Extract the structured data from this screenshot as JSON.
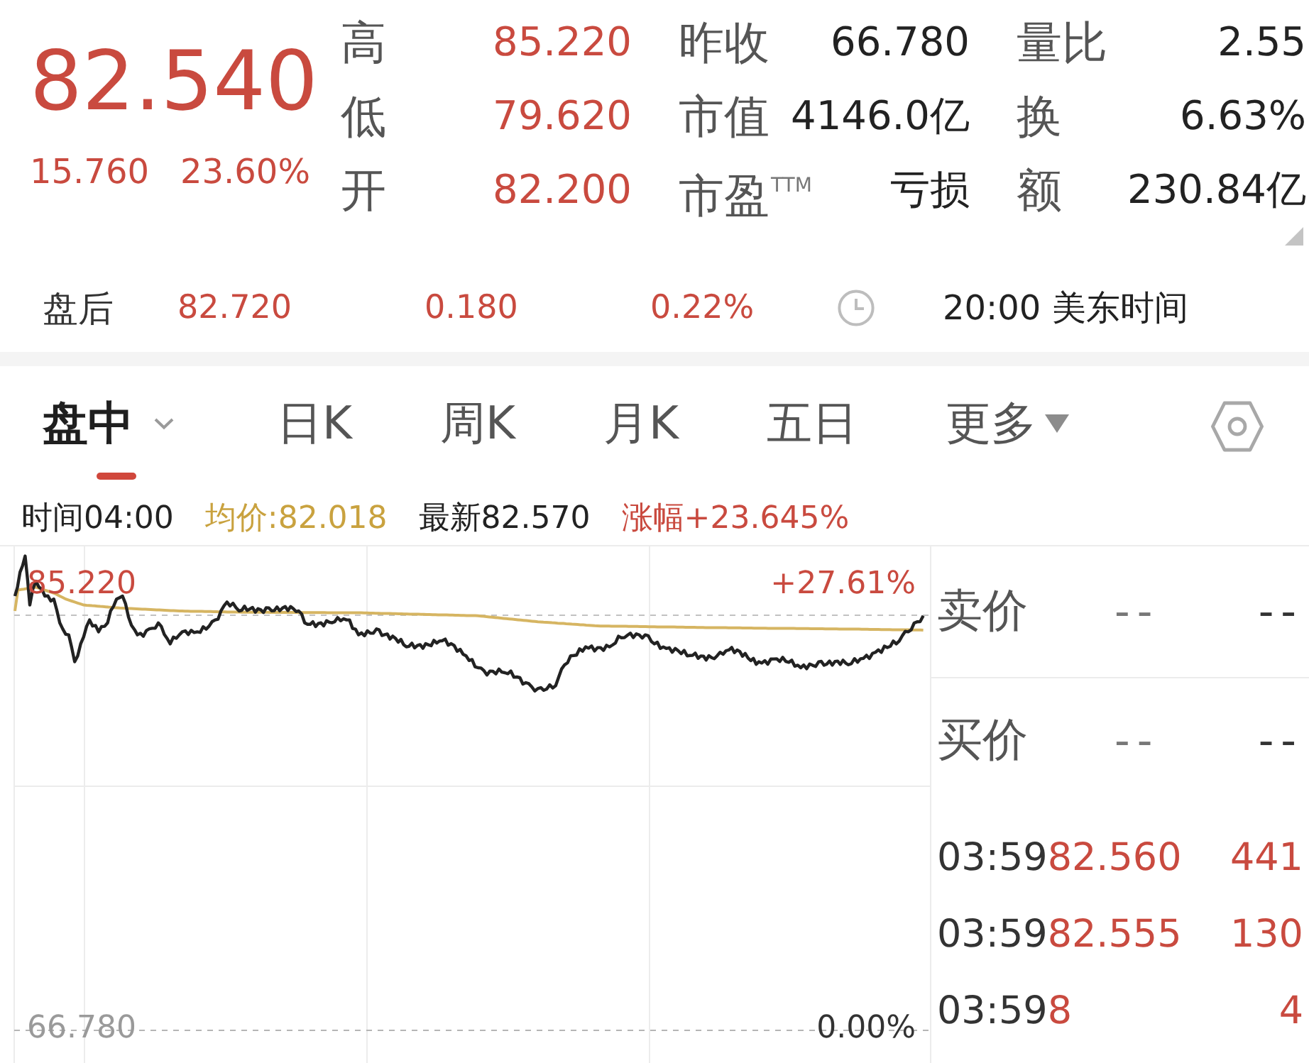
{
  "quote": {
    "price": "82.540",
    "change": "15.760",
    "change_percent": "23.60%"
  },
  "stats": [
    {
      "label": "高",
      "value": "85.220",
      "color": "#c94a3f"
    },
    {
      "label": "昨收",
      "value": "66.780",
      "color": "#222222"
    },
    {
      "label": "量比",
      "value": "2.55",
      "color": "#222222"
    },
    {
      "label": "低",
      "value": "79.620",
      "color": "#c94a3f"
    },
    {
      "label": "市值",
      "value": "4146.0亿",
      "color": "#222222"
    },
    {
      "label": "换",
      "value": "6.63%",
      "color": "#222222"
    },
    {
      "label": "开",
      "value": "82.200",
      "color": "#c94a3f"
    },
    {
      "label": "市盈$^{TTM}$",
      "value": "亏损",
      "color": "#222222"
    },
    {
      "label": "额",
      "value": "230.84亿",
      "color": "#222222"
    }
  ],
  "after_hours": {
    "label": "盘后",
    "price": "82.720",
    "change": "0.180",
    "change_percent": "0.22%",
    "time": "20:00 美东时间"
  },
  "tabs": [
    {
      "label": "盘中",
      "selected": true,
      "kind": "caret"
    },
    {
      "label": "日K",
      "selected": false,
      "kind": "plain"
    },
    {
      "label": "周K",
      "selected": false,
      "kind": "plain"
    },
    {
      "label": "月K",
      "selected": false,
      "kind": "plain"
    },
    {
      "label": "五日",
      "selected": false,
      "kind": "plain"
    },
    {
      "label": "更多",
      "selected": false,
      "kind": "menu"
    }
  ],
  "chart_stats": [
    {
      "text": "时间04:00",
      "color": "#222222"
    },
    {
      "text": "均价:82.018",
      "color": "#c9a23f"
    },
    {
      "text": "最新82.570",
      "color": "#222222"
    },
    {
      "text": "涨幅+23.645%",
      "color": "#c94a3f"
    }
  ],
  "chart": {
    "top_price": "85.220",
    "top_percent": "+27.61%",
    "base_price": "66.780",
    "base_percent": "0.00%"
  },
  "order_book": [
    {
      "label": "卖价",
      "price": "--",
      "volume": "--"
    },
    {
      "label": "买价",
      "price": "--",
      "volume": "--"
    }
  ],
  "trades": [
    {
      "time": "03:59",
      "price": "82.560",
      "volume": "441"
    },
    {
      "time": "03:59",
      "price": "82.555",
      "volume": "130"
    },
    {
      "time": "03:59",
      "price": "8",
      "volume": "4"
    }
  ]
}
